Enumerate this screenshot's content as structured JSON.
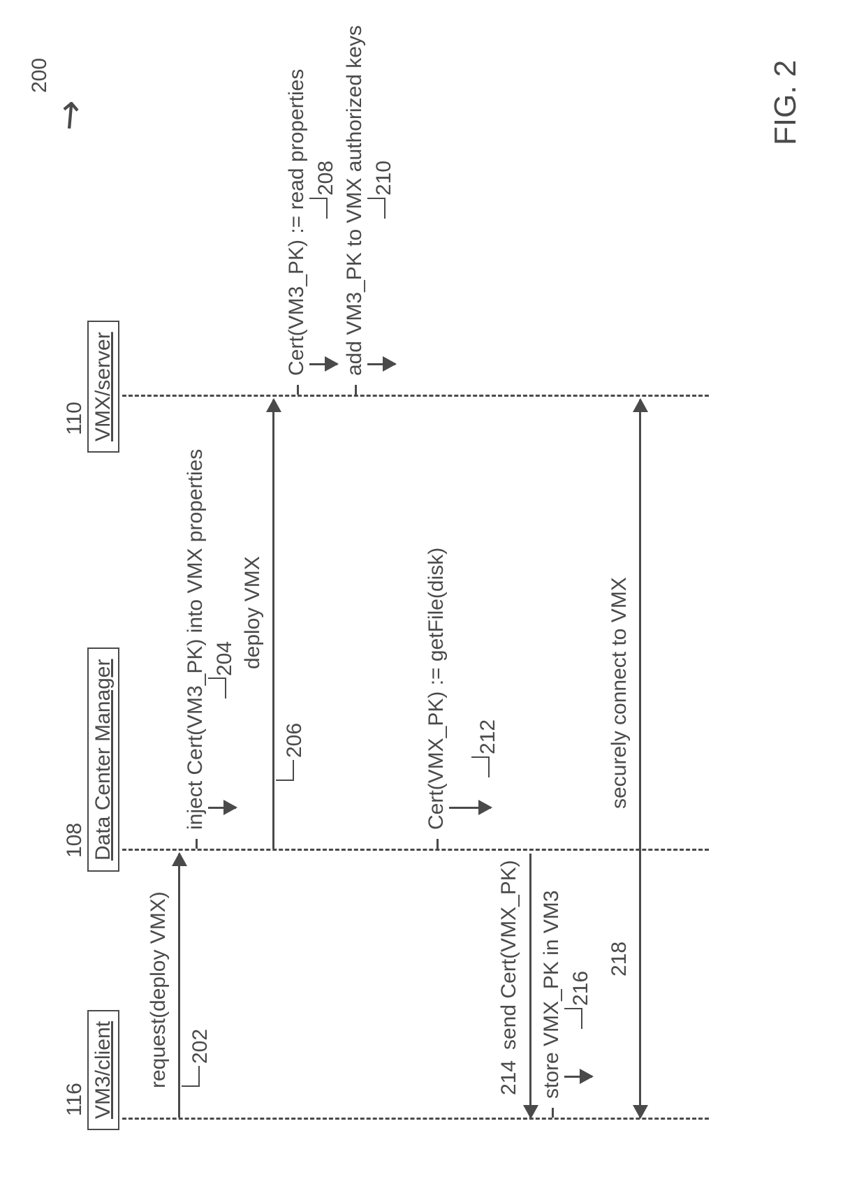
{
  "diagram": {
    "id": "200",
    "figure_label": "FIG. 2",
    "actors": {
      "client": {
        "name": "VM3/client",
        "ref": "116"
      },
      "manager": {
        "name": "Data Center Manager",
        "ref": "108"
      },
      "server": {
        "name": "VMX/server",
        "ref": "110"
      }
    },
    "steps": {
      "s202": {
        "text": "request(deploy VMX)",
        "ref": "202"
      },
      "s204": {
        "text": "inject Cert(VM3_PK) into VMX properties",
        "ref": "204"
      },
      "s206": {
        "text": "deploy VMX",
        "ref": "206"
      },
      "s208": {
        "text": "Cert(VM3_PK) := read properties",
        "ref": "208"
      },
      "s210": {
        "text": "add VM3_PK to VMX authorized keys",
        "ref": "210"
      },
      "s212": {
        "text": "Cert(VMX_PK) := getFile(disk)",
        "ref": "212"
      },
      "s214": {
        "text": "send Cert(VMX_PK)",
        "ref": "214"
      },
      "s216": {
        "text": "store VMX_PK in VM3",
        "ref": "216"
      },
      "s218": {
        "text": "securely connect to VMX",
        "ref": "218"
      }
    }
  }
}
